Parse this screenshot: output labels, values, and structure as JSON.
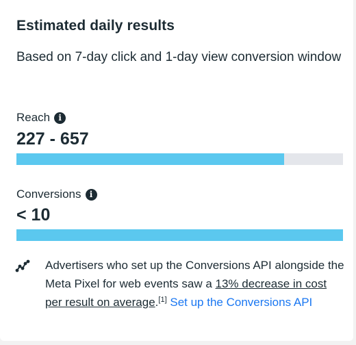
{
  "title": "Estimated daily results",
  "subtitle": "Based on 7-day click and 1-day view conversion window",
  "reach": {
    "label": "Reach",
    "value": "227 - 657",
    "fill_fraction": 0.82
  },
  "conversions": {
    "label": "Conversions",
    "value": "< 10",
    "fill_fraction": 1.0
  },
  "note": {
    "icon": "trend-line-icon",
    "text_before": "Advertisers who set up the Conversions API alongside the Meta Pixel for web events saw a ",
    "highlight": "13% decrease in cost per result on average",
    "after": ".",
    "footnote": "[1]",
    "link_text": "Set up the Conversions API"
  },
  "colors": {
    "bar_fill": "#5bc8ef",
    "bar_track": "#e4e6eb",
    "link": "#1a77f2",
    "text": "#1c2b33"
  }
}
